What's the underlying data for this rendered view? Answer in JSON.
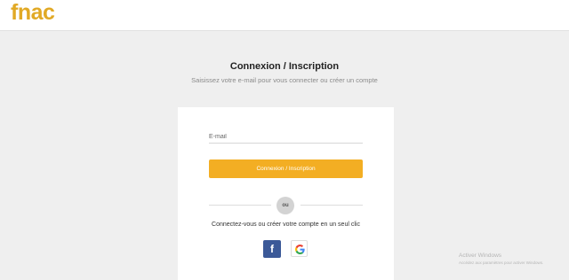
{
  "header": {
    "logo_text": "fnac",
    "brand_color": "#e1a925"
  },
  "main": {
    "title": "Connexion / Inscription",
    "subtitle": "Saisissez votre e-mail pour vous connecter ou créer un compte"
  },
  "form": {
    "email_placeholder": "E-mail",
    "email_value": "",
    "submit_label": "Connexion / Inscription",
    "submit_color": "#f3ae23",
    "separator_label": "ou",
    "social_text": "Connectez-vous ou créer votre compte en un seul clic",
    "social_buttons": [
      {
        "icon": "facebook-icon",
        "label": "f"
      },
      {
        "icon": "google-icon"
      }
    ]
  },
  "os_watermark": {
    "title": "Activer Windows",
    "subtitle": "Accédez aux paramètres pour activer Windows."
  }
}
